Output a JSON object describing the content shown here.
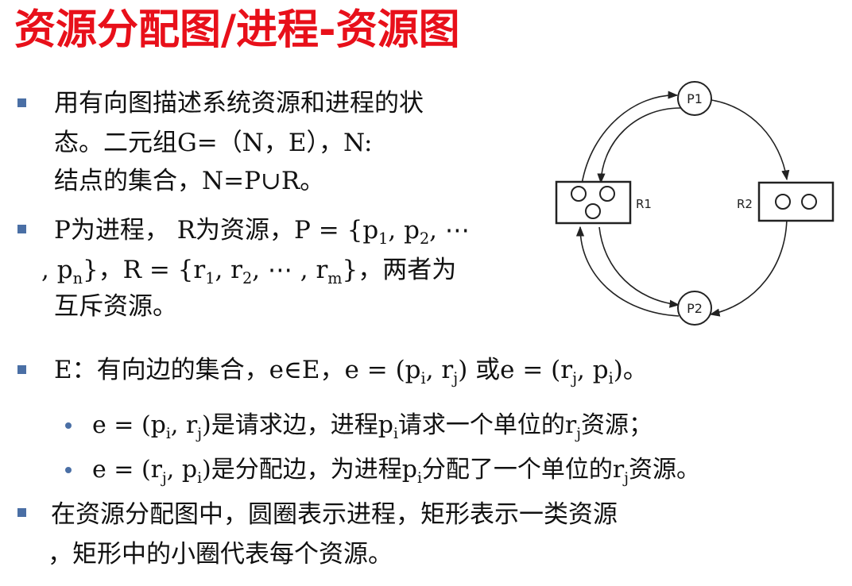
{
  "title": "资源分配图/进程-资源图",
  "b1": {
    "line1": "用有向图描述系统资源和进程的状",
    "line2": "态。二元组G=（N，E），N:",
    "line3": "结点的集合，N=P∪R。"
  },
  "b2": {
    "l1_text": "P为进程， R为资源，P = {p",
    "l1_s1": "1",
    "l1_mid": ", p",
    "l1_s2": "2",
    "l1_end": ", ⋯",
    "l2_start": ", p",
    "l2_sn": "n",
    "l2_mid1": "}，R = {r",
    "l2_s1": "1",
    "l2_mid2": ", r",
    "l2_s2": "2",
    "l2_mid3": ", ⋯ , r",
    "l2_sm": "m",
    "l2_end": "}，两者为",
    "line3": "互斥资源。"
  },
  "b3": {
    "t1": "E：有向边的集合，e∈E，e = (p",
    "s1": "i",
    "t2": ", r",
    "s2": "j",
    "t3": ") 或e = (r",
    "s3": "j",
    "t4": ", p",
    "s4": "i",
    "t5": ")。"
  },
  "sub1": {
    "t1": "e = (p",
    "s1": "i",
    "t2": ", r",
    "s2": "j",
    "t3": ")是请求边，进程p",
    "s3": "i",
    "t4": "请求一个单位的r",
    "s4": "j",
    "t5": "资源；"
  },
  "sub2": {
    "t1": "e = (r",
    "s1": "j",
    "t2": ", p",
    "s2": "i",
    "t3": ")是分配边，为进程p",
    "s3": "i",
    "t4": "分配了一个单位的r",
    "s4": "j",
    "t5": "资源。"
  },
  "b4": {
    "line1": " 在资源分配图中，圆圈表示进程，矩形表示一类资源",
    "line2": "，矩形中的小圈代表每个资源。"
  },
  "diagram": {
    "p1": "P1",
    "p2": "P2",
    "r1": "R1",
    "r2": "R2"
  },
  "colors": {
    "title": "#e8101a",
    "bullet": "#4a6fa5"
  }
}
